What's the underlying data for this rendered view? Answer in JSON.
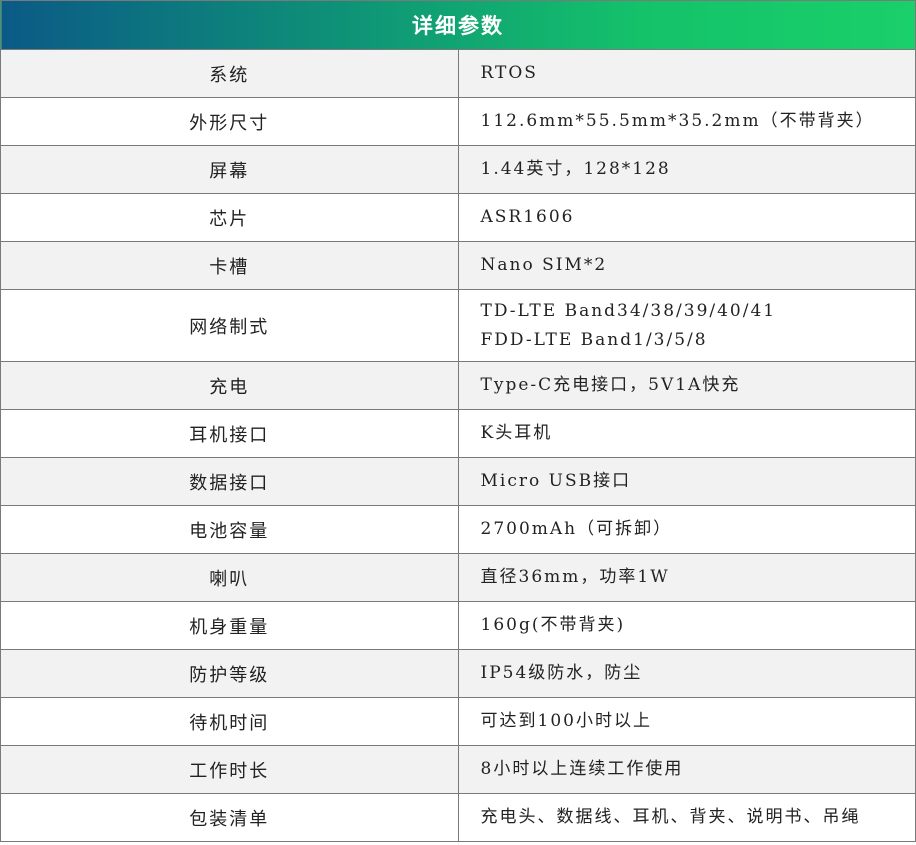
{
  "table": {
    "title": "详细参数",
    "rows": [
      {
        "label": "系统",
        "value": [
          "RTOS"
        ]
      },
      {
        "label": "外形尺寸",
        "value": [
          "112.6mm*55.5mm*35.2mm（不带背夹）"
        ]
      },
      {
        "label": "屏幕",
        "value": [
          "1.44英寸，128*128"
        ]
      },
      {
        "label": "芯片",
        "value": [
          "ASR1606"
        ]
      },
      {
        "label": "卡槽",
        "value": [
          "Nano SIM*2"
        ]
      },
      {
        "label": "网络制式",
        "value": [
          "TD-LTE Band34/38/39/40/41",
          "FDD-LTE Band1/3/5/8"
        ]
      },
      {
        "label": "充电",
        "value": [
          "Type-C充电接口，5V1A快充"
        ]
      },
      {
        "label": "耳机接口",
        "value": [
          "K头耳机"
        ]
      },
      {
        "label": "数据接口",
        "value": [
          "Micro USB接口"
        ]
      },
      {
        "label": "电池容量",
        "value": [
          "2700mAh（可拆卸）"
        ]
      },
      {
        "label": "喇叭",
        "value": [
          "直径36mm，功率1W"
        ]
      },
      {
        "label": "机身重量",
        "value": [
          "160g(不带背夹)"
        ]
      },
      {
        "label": "防护等级",
        "value": [
          "IP54级防水，防尘"
        ]
      },
      {
        "label": "待机时间",
        "value": [
          "可达到100小时以上"
        ]
      },
      {
        "label": "工作时长",
        "value": [
          "8小时以上连续工作使用"
        ]
      },
      {
        "label": "包装清单",
        "value": [
          "充电头、数据线、耳机、背夹、说明书、吊绳"
        ]
      }
    ]
  }
}
